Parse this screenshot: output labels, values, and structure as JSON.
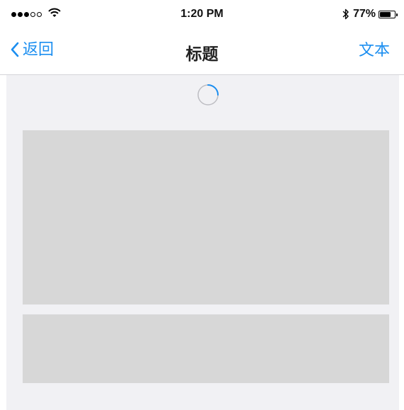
{
  "status_bar": {
    "signal_bars_filled": 3,
    "signal_bars_total": 5,
    "time": "1:20 PM",
    "battery_percent": "77%",
    "battery_level": 0.77
  },
  "nav": {
    "back_label": "返回",
    "title": "标题",
    "right_label": "文本"
  },
  "colors": {
    "accent": "#1b8ef0",
    "content_bg": "#f1f1f4",
    "placeholder": "#d7d7d7"
  },
  "icons": {
    "back": "chevron-left-icon",
    "wifi": "wifi-icon",
    "bluetooth": "bluetooth-icon",
    "battery": "battery-icon",
    "loading": "loading-spinner-icon"
  }
}
